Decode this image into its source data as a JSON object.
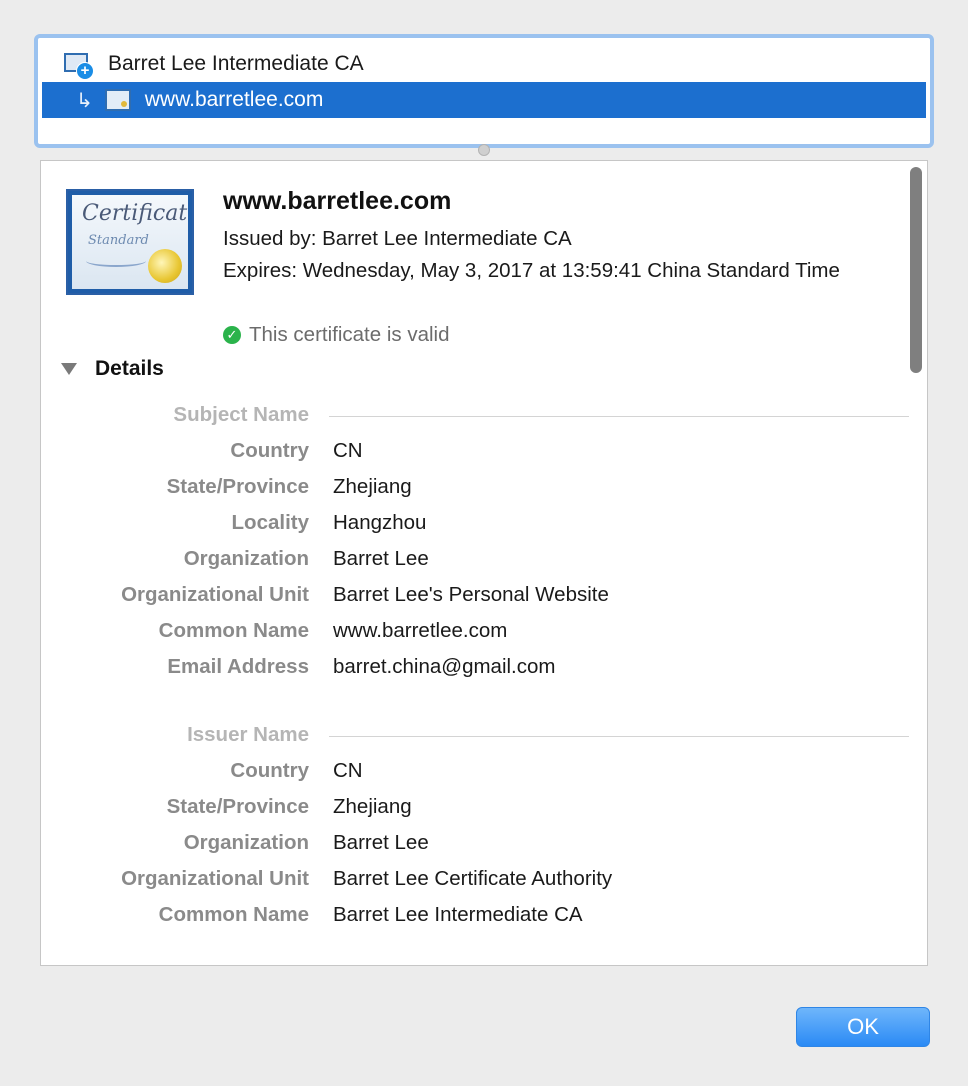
{
  "chain": {
    "items": [
      {
        "label": "Barret Lee Intermediate CA",
        "icon": "ca-certificate-icon",
        "selected": false
      },
      {
        "label": "www.barretlee.com",
        "icon": "certificate-icon",
        "selected": true,
        "arrow": "↳"
      }
    ]
  },
  "certificate": {
    "image_text_1": "Certificate",
    "image_text_2": "Standard",
    "title": "www.barretlee.com",
    "issued_by": "Issued by: Barret Lee Intermediate CA",
    "expires": "Expires: Wednesday, May 3, 2017 at 13:59:41 China Standard Time",
    "valid_text": "This certificate is valid",
    "valid_check": "✓",
    "valid_color": "#2bb34b"
  },
  "details": {
    "label": "Details",
    "subject": {
      "heading": "Subject Name",
      "fields": [
        {
          "key": "Country",
          "value": "CN"
        },
        {
          "key": "State/Province",
          "value": "Zhejiang"
        },
        {
          "key": "Locality",
          "value": "Hangzhou"
        },
        {
          "key": "Organization",
          "value": "Barret Lee"
        },
        {
          "key": "Organizational Unit",
          "value": "Barret Lee's Personal Website"
        },
        {
          "key": "Common Name",
          "value": "www.barretlee.com"
        },
        {
          "key": "Email Address",
          "value": "barret.china@gmail.com"
        }
      ]
    },
    "issuer": {
      "heading": "Issuer Name",
      "fields": [
        {
          "key": "Country",
          "value": "CN"
        },
        {
          "key": "State/Province",
          "value": "Zhejiang"
        },
        {
          "key": "Organization",
          "value": "Barret Lee"
        },
        {
          "key": "Organizational Unit",
          "value": "Barret Lee Certificate Authority"
        },
        {
          "key": "Common Name",
          "value": "Barret Lee Intermediate CA"
        }
      ]
    }
  },
  "ok_button": {
    "label": "OK"
  },
  "colors": {
    "selection": "#1c6fcf",
    "accent": "#2a8af5"
  }
}
